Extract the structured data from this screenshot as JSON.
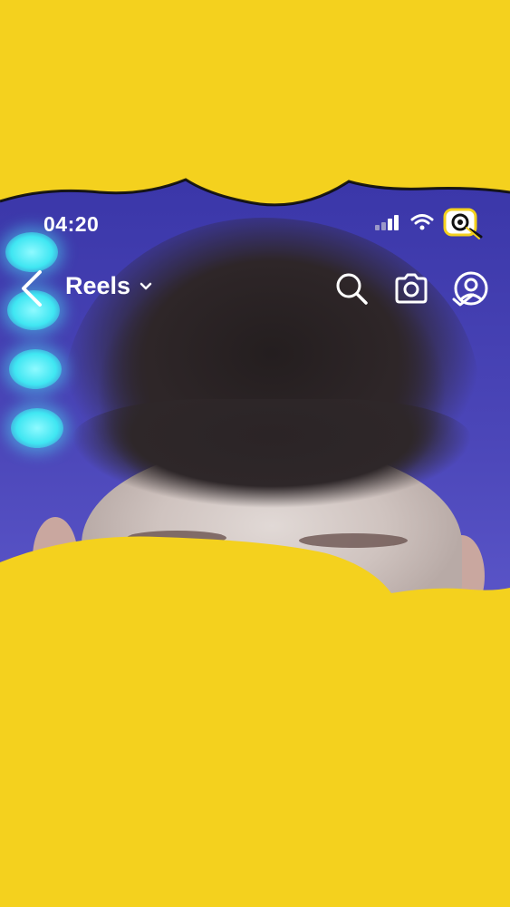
{
  "status_bar": {
    "time": "04:20"
  },
  "header": {
    "title": "Reels"
  },
  "icons": {
    "back": "chevron-left-icon",
    "title_dropdown": "chevron-down-icon",
    "search": "search-icon",
    "camera": "camera-icon",
    "profile": "profile-icon",
    "signal": "signal-icon",
    "wifi": "wifi-icon",
    "overlay_sticker": "camera-sticker-icon"
  },
  "colors": {
    "background_yellow": "#F4D11E",
    "video_blue": "#4b46b8",
    "light_cyan": "#3fe6f2",
    "header_text": "#FFFFFF"
  }
}
